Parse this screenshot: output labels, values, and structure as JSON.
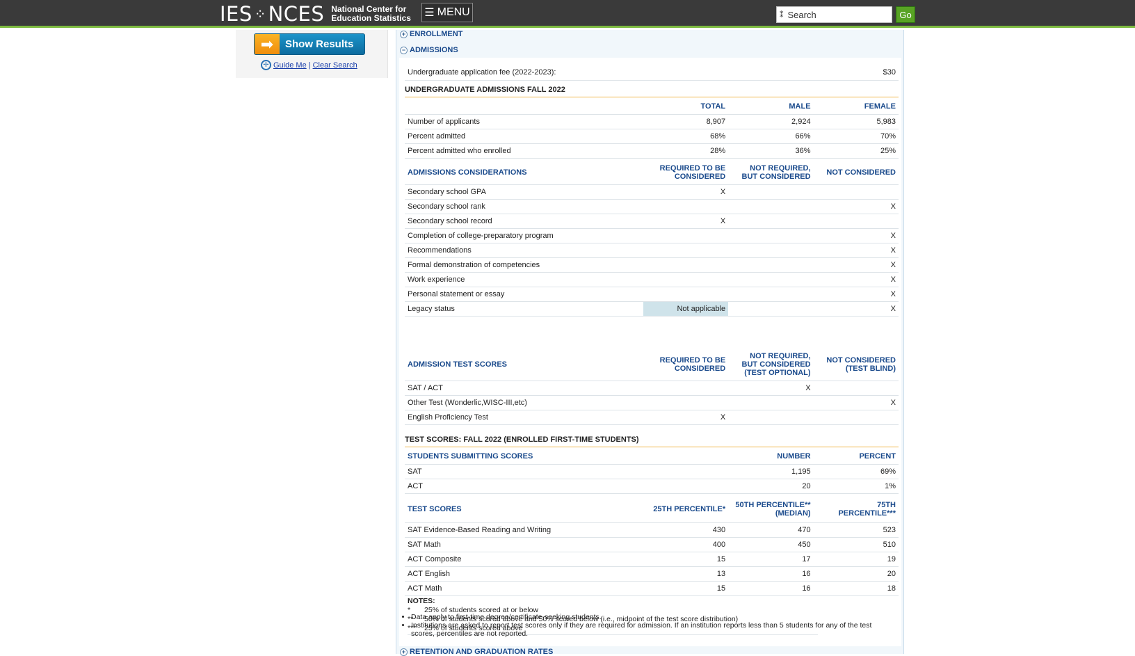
{
  "header": {
    "logo_ies": "IES",
    "logo_nces": "NCES",
    "logo_tag_line1": "National Center for",
    "logo_tag_line2": "Education Statistics",
    "menu_label": "MENU",
    "search_placeholder": "Search",
    "go_label": "Go"
  },
  "sidebar": {
    "show_results": "Show Results",
    "guide_me": "Guide Me",
    "separator": "|",
    "clear_search": "Clear Search"
  },
  "sections": {
    "enrollment": "ENROLLMENT",
    "admissions": "ADMISSIONS",
    "retention": "RETENTION AND GRADUATION RATES"
  },
  "admissions": {
    "fee_label": "Undergraduate application fee (2022-2023):",
    "fee_value": "$30",
    "fall_caption": "UNDERGRADUATE ADMISSIONS FALL 2022",
    "fall_headers": [
      "TOTAL",
      "MALE",
      "FEMALE"
    ],
    "fall_rows": [
      {
        "label": "Number of applicants",
        "total": "8,907",
        "male": "2,924",
        "female": "5,983"
      },
      {
        "label": "Percent admitted",
        "total": "68%",
        "male": "66%",
        "female": "70%"
      },
      {
        "label": "Percent admitted who enrolled",
        "total": "28%",
        "male": "36%",
        "female": "25%"
      }
    ],
    "considerations": {
      "title": "ADMISSIONS CONSIDERATIONS",
      "h1a": "REQUIRED TO BE",
      "h1b": "CONSIDERED",
      "h2a": "NOT REQUIRED,",
      "h2b": "BUT CONSIDERED",
      "h3": "NOT CONSIDERED",
      "rows": [
        {
          "label": "Secondary school GPA",
          "req": "X",
          "nreq": "",
          "notc": ""
        },
        {
          "label": "Secondary school rank",
          "req": "",
          "nreq": "",
          "notc": "X"
        },
        {
          "label": "Secondary school record",
          "req": "X",
          "nreq": "",
          "notc": ""
        },
        {
          "label": "Completion of college-preparatory program",
          "req": "",
          "nreq": "",
          "notc": "X"
        },
        {
          "label": "Recommendations",
          "req": "",
          "nreq": "",
          "notc": "X"
        },
        {
          "label": "Formal demonstration of competencies",
          "req": "",
          "nreq": "",
          "notc": "X"
        },
        {
          "label": "Work experience",
          "req": "",
          "nreq": "",
          "notc": "X"
        },
        {
          "label": "Personal statement or essay",
          "req": "",
          "nreq": "",
          "notc": "X"
        },
        {
          "label": "Legacy status",
          "req": "Not applicable",
          "nreq": "",
          "notc": "X"
        }
      ]
    },
    "tests": {
      "title": "ADMISSION TEST SCORES",
      "h1a": "REQUIRED TO BE",
      "h1b": "CONSIDERED",
      "h2a": "NOT REQUIRED,",
      "h2b": "BUT CONSIDERED",
      "h2c": "(TEST OPTIONAL)",
      "h3a": "NOT CONSIDERED",
      "h3b": "(TEST BLIND)",
      "rows": [
        {
          "label": "SAT / ACT",
          "req": "",
          "nreq": "X",
          "notc": ""
        },
        {
          "label": "Other Test (Wonderlic,WISC-III,etc)",
          "req": "",
          "nreq": "",
          "notc": "X"
        },
        {
          "label": "English Proficiency Test",
          "req": "X",
          "nreq": "",
          "notc": ""
        }
      ]
    },
    "scores_caption": "TEST SCORES: FALL 2022 (ENROLLED FIRST-TIME STUDENTS)",
    "submitting": {
      "title": "STUDENTS SUBMITTING SCORES",
      "h_number": "NUMBER",
      "h_percent": "PERCENT",
      "rows": [
        {
          "label": "SAT",
          "number": "1,195",
          "percent": "69%"
        },
        {
          "label": "ACT",
          "number": "20",
          "percent": "1%"
        }
      ]
    },
    "scores": {
      "title": "TEST SCORES",
      "h25": "25TH PERCENTILE*",
      "h50a": "50TH PERCENTILE**",
      "h50b": "(MEDIAN)",
      "h75a": "75TH",
      "h75b": "PERCENTILE***",
      "rows": [
        {
          "label": "SAT Evidence-Based Reading and Writing",
          "p25": "430",
          "p50": "470",
          "p75": "523"
        },
        {
          "label": "SAT Math",
          "p25": "400",
          "p50": "450",
          "p75": "510"
        },
        {
          "label": "ACT Composite",
          "p25": "15",
          "p50": "17",
          "p75": "19"
        },
        {
          "label": "ACT English",
          "p25": "13",
          "p50": "16",
          "p75": "20"
        },
        {
          "label": "ACT Math",
          "p25": "15",
          "p50": "16",
          "p75": "18"
        }
      ]
    },
    "notes": {
      "title": "NOTES:",
      "n1sym": "*",
      "n1": "25% of students scored at or below",
      "n2sym": "**",
      "n2": "50% of students scored above and 50% scored below (i.e., midpoint of the test score distribution)",
      "n3sym": "***",
      "n3": "25% of students scored above",
      "b1": "Data apply to first-time degree/certificate-seeking students.",
      "b2": "Institutions are asked to report test scores only if they are required for admission. If an institution reports less than 5 students for any of the test scores, percentiles are not reported."
    }
  }
}
